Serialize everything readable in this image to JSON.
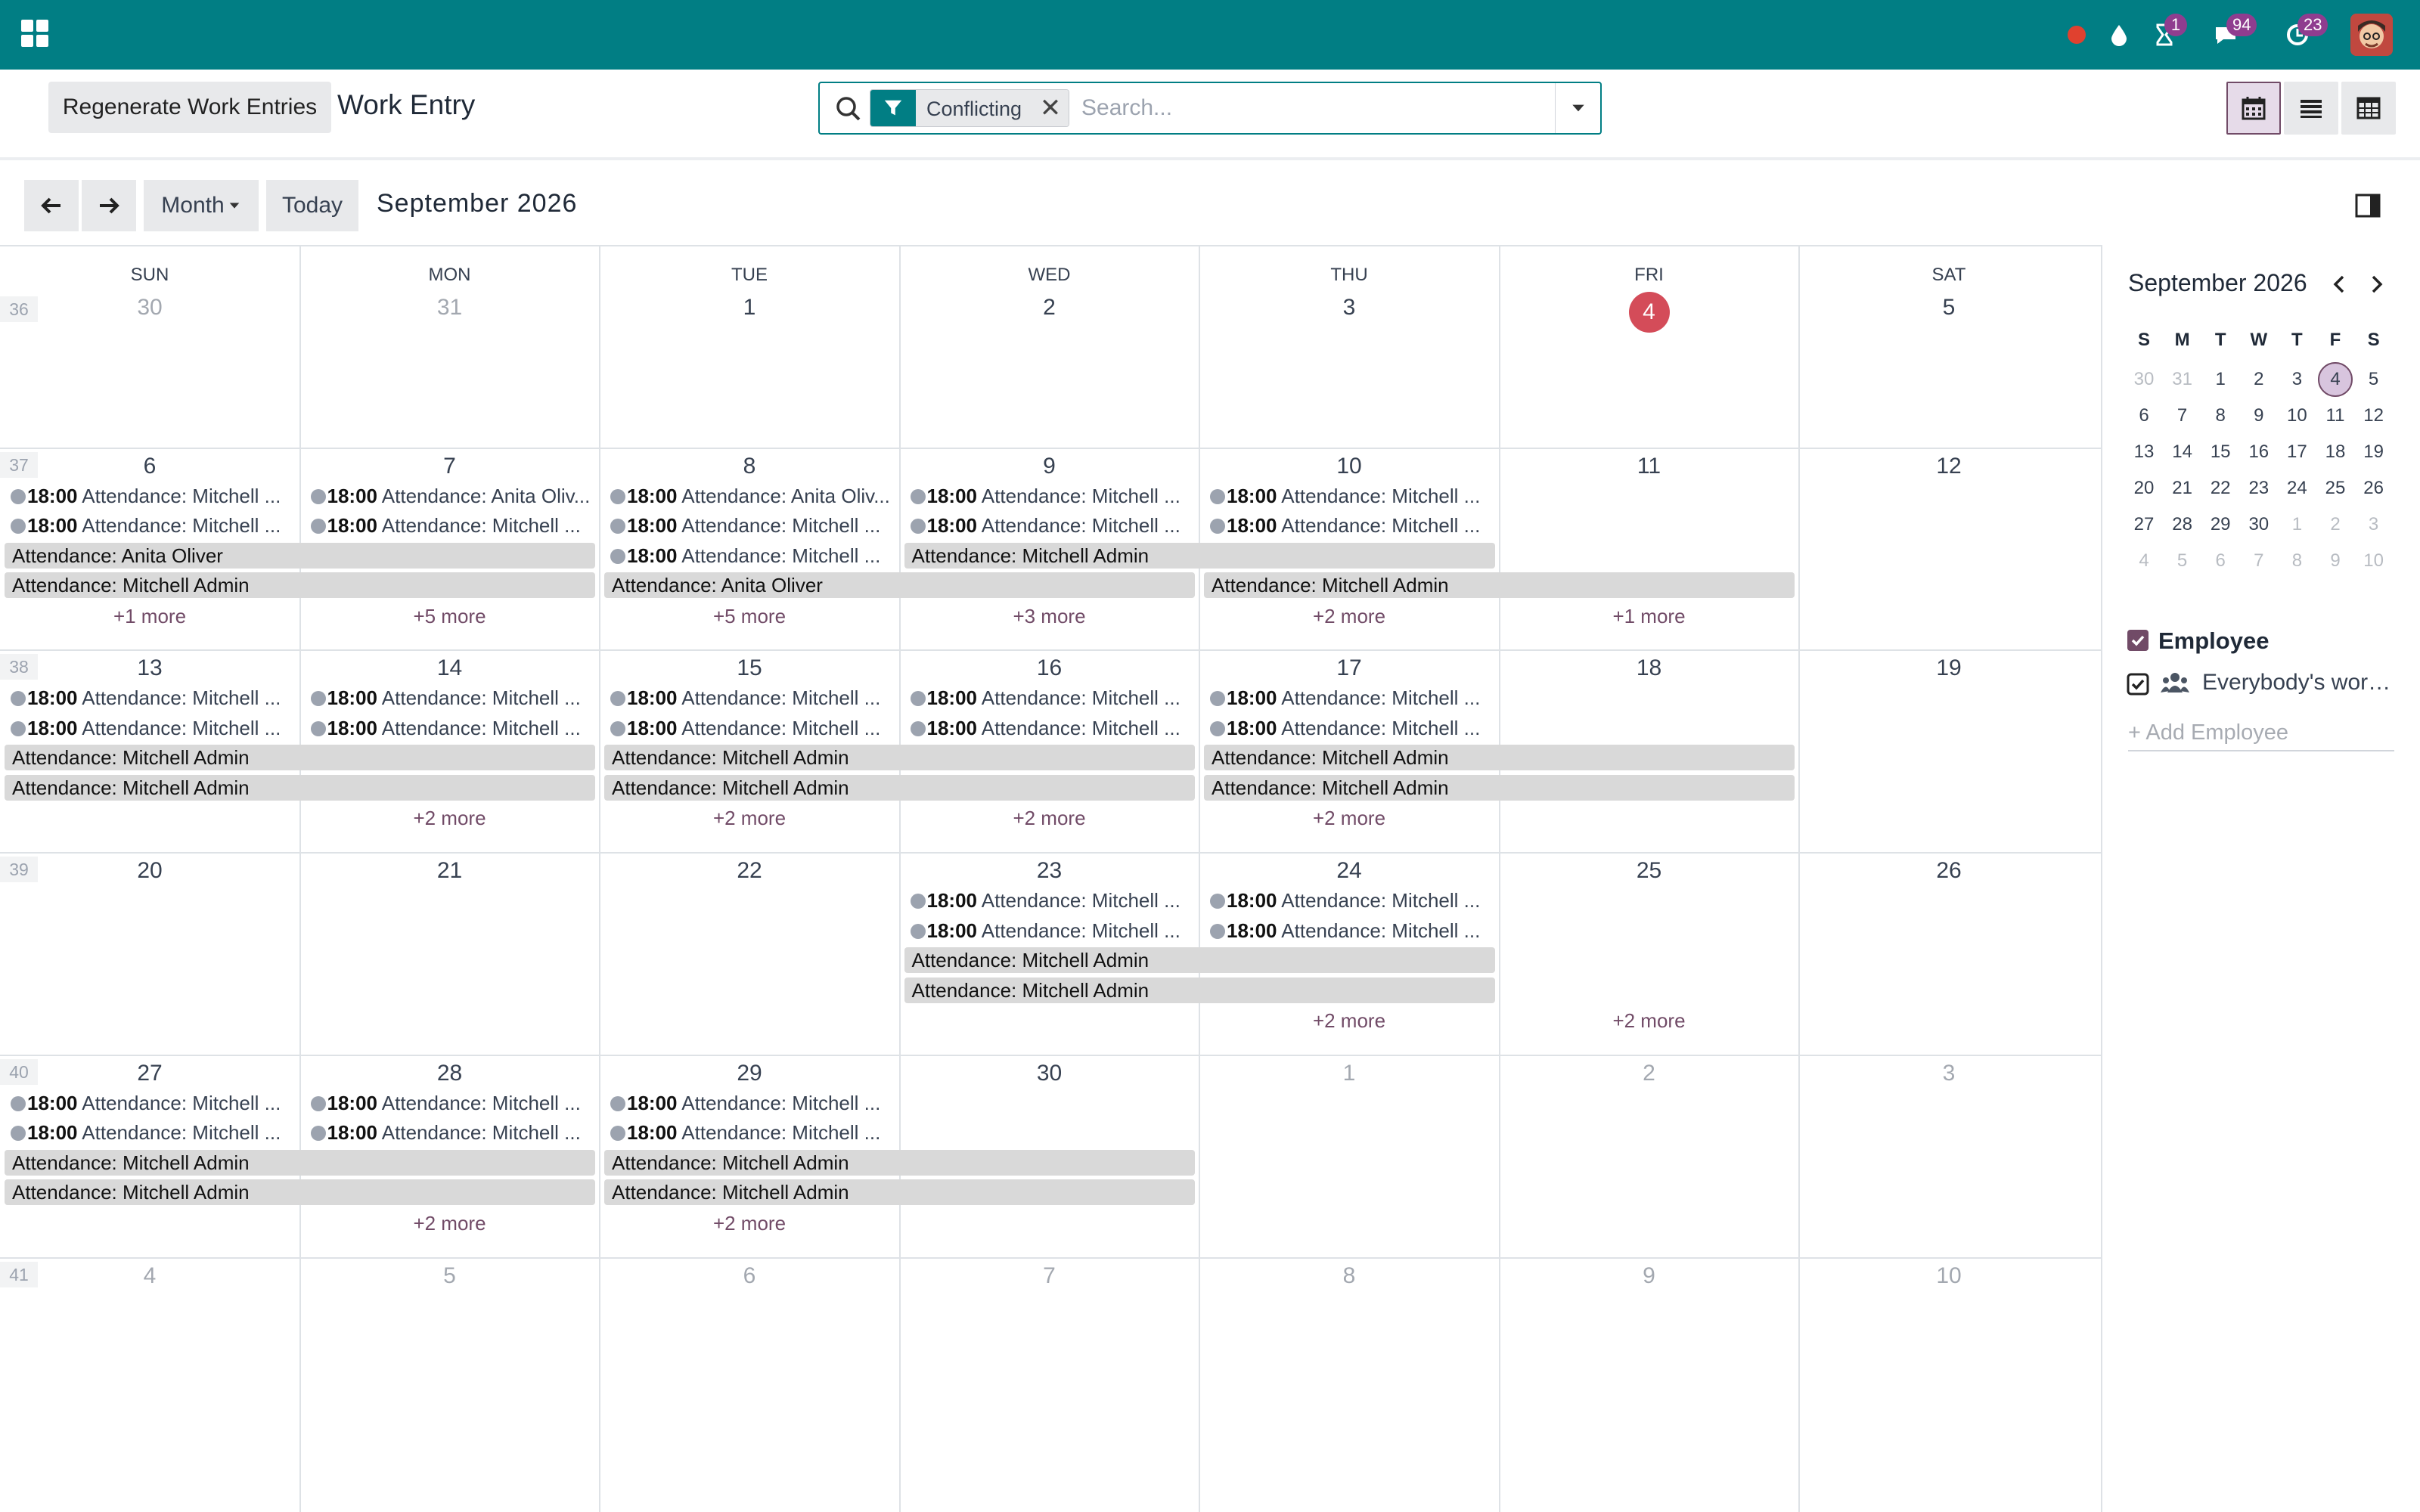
{
  "navbar": {
    "systray": [
      {
        "name": "status-dot",
        "badge": ""
      },
      {
        "name": "drop-icon",
        "badge": ""
      },
      {
        "name": "hourglass-icon",
        "badge": "1"
      },
      {
        "name": "messaging-icon",
        "badge": "94"
      },
      {
        "name": "activity-icon",
        "badge": "23"
      }
    ]
  },
  "control_panel": {
    "regenerate_label": "Regenerate Work Entries",
    "title": "Work Entry",
    "search": {
      "facet_label": "Conflicting",
      "placeholder": "Search..."
    }
  },
  "toolbar": {
    "scale_label": "Month",
    "today_label": "Today",
    "period_title": "September 2026"
  },
  "calendar": {
    "weekdays": [
      "SUN",
      "MON",
      "TUE",
      "WED",
      "THU",
      "FRI",
      "SAT"
    ],
    "weeks": [
      {
        "number": "36",
        "days": [
          "30",
          "31",
          "1",
          "2",
          "3",
          "4",
          "5"
        ]
      },
      {
        "number": "37",
        "days": [
          "6",
          "7",
          "8",
          "9",
          "10",
          "11",
          "12"
        ]
      },
      {
        "number": "38",
        "days": [
          "13",
          "14",
          "15",
          "16",
          "17",
          "18",
          "19"
        ]
      },
      {
        "number": "39",
        "days": [
          "20",
          "21",
          "22",
          "23",
          "24",
          "25",
          "26"
        ]
      },
      {
        "number": "40",
        "days": [
          "27",
          "28",
          "29",
          "30",
          "1",
          "2",
          "3"
        ]
      },
      {
        "number": "41",
        "days": [
          "4",
          "5",
          "6",
          "7",
          "8",
          "9",
          "10"
        ]
      }
    ],
    "muted_days": [
      [
        0,
        0
      ],
      [
        0,
        1
      ],
      [
        4,
        4
      ],
      [
        4,
        5
      ],
      [
        4,
        6
      ],
      [
        5,
        0
      ],
      [
        5,
        1
      ],
      [
        5,
        2
      ],
      [
        5,
        3
      ],
      [
        5,
        4
      ],
      [
        5,
        5
      ],
      [
        5,
        6
      ]
    ],
    "today": [
      0,
      5
    ],
    "timed_events": [
      {
        "w": 1,
        "d": 0,
        "slot": 0,
        "time": "18:00",
        "text": "Attendance: Mitchell ..."
      },
      {
        "w": 1,
        "d": 0,
        "slot": 1,
        "time": "18:00",
        "text": "Attendance: Mitchell ..."
      },
      {
        "w": 1,
        "d": 1,
        "slot": 0,
        "time": "18:00",
        "text": "Attendance: Anita Oliv..."
      },
      {
        "w": 1,
        "d": 1,
        "slot": 1,
        "time": "18:00",
        "text": "Attendance: Mitchell ..."
      },
      {
        "w": 1,
        "d": 2,
        "slot": 0,
        "time": "18:00",
        "text": "Attendance: Anita Oliv..."
      },
      {
        "w": 1,
        "d": 2,
        "slot": 1,
        "time": "18:00",
        "text": "Attendance: Mitchell ..."
      },
      {
        "w": 1,
        "d": 2,
        "slot": 2,
        "time": "18:00",
        "text": "Attendance: Mitchell ..."
      },
      {
        "w": 1,
        "d": 3,
        "slot": 0,
        "time": "18:00",
        "text": "Attendance: Mitchell ..."
      },
      {
        "w": 1,
        "d": 3,
        "slot": 1,
        "time": "18:00",
        "text": "Attendance: Mitchell ..."
      },
      {
        "w": 1,
        "d": 4,
        "slot": 0,
        "time": "18:00",
        "text": "Attendance: Mitchell ..."
      },
      {
        "w": 1,
        "d": 4,
        "slot": 1,
        "time": "18:00",
        "text": "Attendance: Mitchell ..."
      },
      {
        "w": 2,
        "d": 0,
        "slot": 0,
        "time": "18:00",
        "text": "Attendance: Mitchell ..."
      },
      {
        "w": 2,
        "d": 0,
        "slot": 1,
        "time": "18:00",
        "text": "Attendance: Mitchell ..."
      },
      {
        "w": 2,
        "d": 1,
        "slot": 0,
        "time": "18:00",
        "text": "Attendance: Mitchell ..."
      },
      {
        "w": 2,
        "d": 1,
        "slot": 1,
        "time": "18:00",
        "text": "Attendance: Mitchell ..."
      },
      {
        "w": 2,
        "d": 2,
        "slot": 0,
        "time": "18:00",
        "text": "Attendance: Mitchell ..."
      },
      {
        "w": 2,
        "d": 2,
        "slot": 1,
        "time": "18:00",
        "text": "Attendance: Mitchell ..."
      },
      {
        "w": 2,
        "d": 3,
        "slot": 0,
        "time": "18:00",
        "text": "Attendance: Mitchell ..."
      },
      {
        "w": 2,
        "d": 3,
        "slot": 1,
        "time": "18:00",
        "text": "Attendance: Mitchell ..."
      },
      {
        "w": 2,
        "d": 4,
        "slot": 0,
        "time": "18:00",
        "text": "Attendance: Mitchell ..."
      },
      {
        "w": 2,
        "d": 4,
        "slot": 1,
        "time": "18:00",
        "text": "Attendance: Mitchell ..."
      },
      {
        "w": 3,
        "d": 3,
        "slot": 0,
        "time": "18:00",
        "text": "Attendance: Mitchell ..."
      },
      {
        "w": 3,
        "d": 3,
        "slot": 1,
        "time": "18:00",
        "text": "Attendance: Mitchell ..."
      },
      {
        "w": 3,
        "d": 4,
        "slot": 0,
        "time": "18:00",
        "text": "Attendance: Mitchell ..."
      },
      {
        "w": 3,
        "d": 4,
        "slot": 1,
        "time": "18:00",
        "text": "Attendance: Mitchell ..."
      },
      {
        "w": 4,
        "d": 0,
        "slot": 0,
        "time": "18:00",
        "text": "Attendance: Mitchell ..."
      },
      {
        "w": 4,
        "d": 0,
        "slot": 1,
        "time": "18:00",
        "text": "Attendance: Mitchell ..."
      },
      {
        "w": 4,
        "d": 1,
        "slot": 0,
        "time": "18:00",
        "text": "Attendance: Mitchell ..."
      },
      {
        "w": 4,
        "d": 1,
        "slot": 1,
        "time": "18:00",
        "text": "Attendance: Mitchell ..."
      },
      {
        "w": 4,
        "d": 2,
        "slot": 0,
        "time": "18:00",
        "text": "Attendance: Mitchell ..."
      },
      {
        "w": 4,
        "d": 2,
        "slot": 1,
        "time": "18:00",
        "text": "Attendance: Mitchell ..."
      }
    ],
    "bars": [
      {
        "w": 1,
        "start": 0,
        "span": 2,
        "slot": 2,
        "text": "Attendance: Anita Oliver"
      },
      {
        "w": 1,
        "start": 0,
        "span": 2,
        "slot": 3,
        "text": "Attendance: Mitchell Admin"
      },
      {
        "w": 1,
        "start": 3,
        "span": 2,
        "slot": 2,
        "text": "Attendance: Mitchell Admin"
      },
      {
        "w": 1,
        "start": 2,
        "span": 2,
        "slot": 3,
        "text": "Attendance: Anita Oliver"
      },
      {
        "w": 1,
        "start": 4,
        "span": 2,
        "slot": 3,
        "text": "Attendance: Mitchell Admin"
      },
      {
        "w": 2,
        "start": 0,
        "span": 2,
        "slot": 2,
        "text": "Attendance: Mitchell Admin"
      },
      {
        "w": 2,
        "start": 0,
        "span": 2,
        "slot": 3,
        "text": "Attendance: Mitchell Admin"
      },
      {
        "w": 2,
        "start": 2,
        "span": 2,
        "slot": 2,
        "text": "Attendance: Mitchell Admin"
      },
      {
        "w": 2,
        "start": 2,
        "span": 2,
        "slot": 3,
        "text": "Attendance: Mitchell Admin"
      },
      {
        "w": 2,
        "start": 4,
        "span": 2,
        "slot": 2,
        "text": "Attendance: Mitchell Admin"
      },
      {
        "w": 2,
        "start": 4,
        "span": 2,
        "slot": 3,
        "text": "Attendance: Mitchell Admin"
      },
      {
        "w": 3,
        "start": 3,
        "span": 2,
        "slot": 2,
        "text": "Attendance: Mitchell Admin"
      },
      {
        "w": 3,
        "start": 3,
        "span": 2,
        "slot": 3,
        "text": "Attendance: Mitchell Admin"
      },
      {
        "w": 4,
        "start": 0,
        "span": 2,
        "slot": 2,
        "text": "Attendance: Mitchell Admin"
      },
      {
        "w": 4,
        "start": 0,
        "span": 2,
        "slot": 3,
        "text": "Attendance: Mitchell Admin"
      },
      {
        "w": 4,
        "start": 2,
        "span": 2,
        "slot": 2,
        "text": "Attendance: Mitchell Admin"
      },
      {
        "w": 4,
        "start": 2,
        "span": 2,
        "slot": 3,
        "text": "Attendance: Mitchell Admin"
      }
    ],
    "more_links": [
      {
        "w": 1,
        "d": 0,
        "text": "+1 more"
      },
      {
        "w": 1,
        "d": 1,
        "text": "+5 more"
      },
      {
        "w": 1,
        "d": 2,
        "text": "+5 more"
      },
      {
        "w": 1,
        "d": 3,
        "text": "+3 more"
      },
      {
        "w": 1,
        "d": 4,
        "text": "+2 more"
      },
      {
        "w": 1,
        "d": 5,
        "text": "+1 more"
      },
      {
        "w": 2,
        "d": 1,
        "text": "+2 more"
      },
      {
        "w": 2,
        "d": 2,
        "text": "+2 more"
      },
      {
        "w": 2,
        "d": 3,
        "text": "+2 more"
      },
      {
        "w": 2,
        "d": 4,
        "text": "+2 more"
      },
      {
        "w": 3,
        "d": 4,
        "text": "+2 more"
      },
      {
        "w": 3,
        "d": 5,
        "text": "+2 more"
      },
      {
        "w": 4,
        "d": 1,
        "text": "+2 more"
      },
      {
        "w": 4,
        "d": 2,
        "text": "+2 more"
      }
    ]
  },
  "side_panel": {
    "mini_title": "September 2026",
    "mini_weekdays": [
      "S",
      "M",
      "T",
      "W",
      "T",
      "F",
      "S"
    ],
    "mini_weeks": [
      [
        "30",
        "31",
        "1",
        "2",
        "3",
        "4",
        "5"
      ],
      [
        "6",
        "7",
        "8",
        "9",
        "10",
        "11",
        "12"
      ],
      [
        "13",
        "14",
        "15",
        "16",
        "17",
        "18",
        "19"
      ],
      [
        "20",
        "21",
        "22",
        "23",
        "24",
        "25",
        "26"
      ],
      [
        "27",
        "28",
        "29",
        "30",
        "1",
        "2",
        "3"
      ],
      [
        "4",
        "5",
        "6",
        "7",
        "8",
        "9",
        "10"
      ]
    ],
    "mini_muted": [
      [
        0,
        0
      ],
      [
        0,
        1
      ],
      [
        4,
        4
      ],
      [
        4,
        5
      ],
      [
        4,
        6
      ],
      [
        5,
        0
      ],
      [
        5,
        1
      ],
      [
        5,
        2
      ],
      [
        5,
        3
      ],
      [
        5,
        4
      ],
      [
        5,
        5
      ],
      [
        5,
        6
      ]
    ],
    "mini_today": [
      0,
      5
    ],
    "filter_title": "Employee",
    "filter_item": "Everybody's work...",
    "add_placeholder": "+ Add Employee",
    "accent_color": "#714b67"
  }
}
